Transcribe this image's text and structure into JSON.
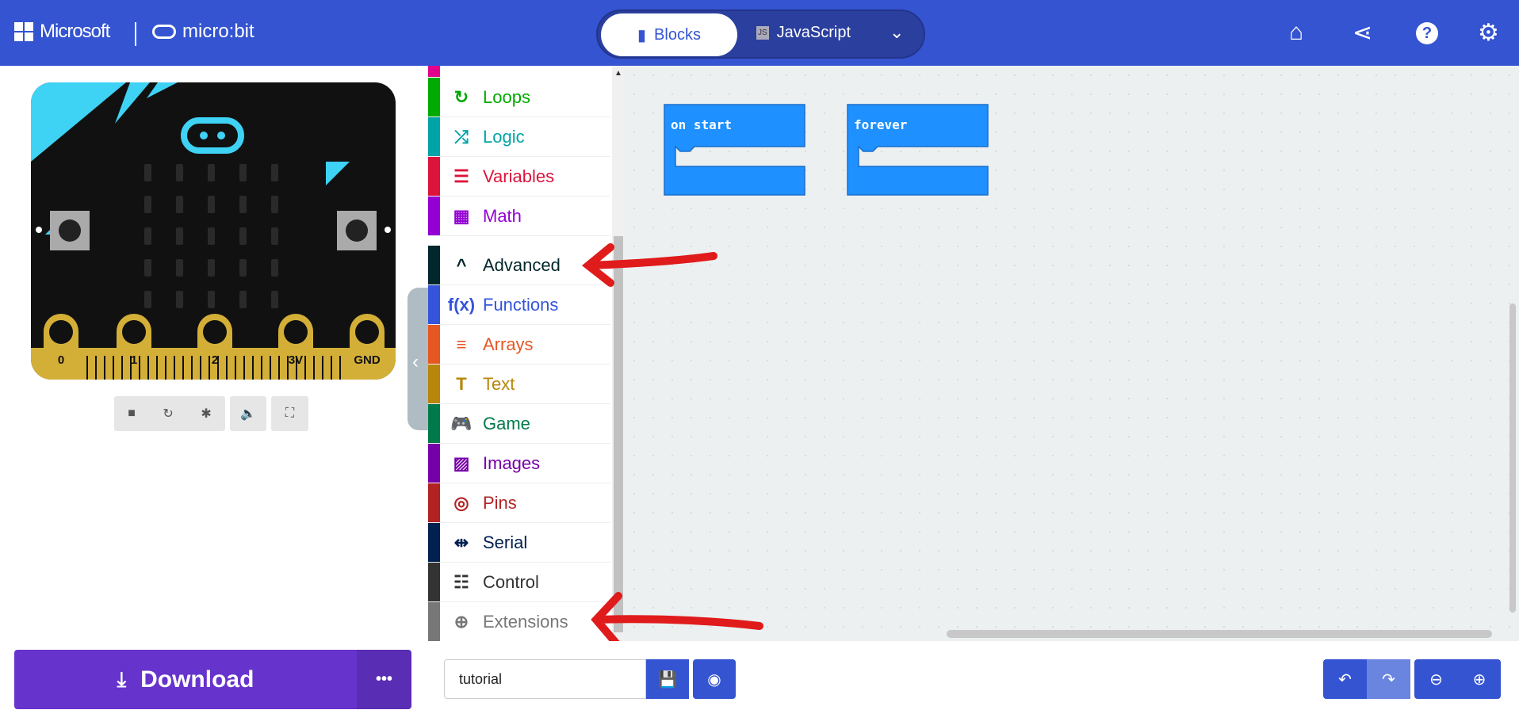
{
  "header": {
    "brand": "Microsoft",
    "product": "micro:bit",
    "tabs": [
      {
        "label": "Blocks"
      },
      {
        "label": "JavaScript"
      }
    ],
    "icons": [
      "home-icon",
      "share-icon",
      "help-icon",
      "settings-icon"
    ]
  },
  "simulator": {
    "pins": [
      "0",
      "1",
      "2",
      "3V",
      "GND"
    ],
    "buttons": [
      "A",
      "B"
    ],
    "controls": [
      "stop-icon",
      "restart-icon",
      "debug-icon",
      "mute-icon",
      "fullscreen-icon"
    ]
  },
  "toolbox": {
    "items": [
      {
        "label": "Loops",
        "icon": "↻",
        "color": "#00aa00"
      },
      {
        "label": "Logic",
        "icon": "⤮",
        "color": "#00a4a6"
      },
      {
        "label": "Variables",
        "icon": "☰",
        "color": "#dc143c"
      },
      {
        "label": "Math",
        "icon": "▦",
        "color": "#9400d3"
      },
      {
        "label": "Advanced",
        "icon": "^",
        "color": "#00272b"
      },
      {
        "label": "Functions",
        "icon": "f(x)",
        "color": "#3455db"
      },
      {
        "label": "Arrays",
        "icon": "≡",
        "color": "#e65722"
      },
      {
        "label": "Text",
        "icon": "T",
        "color": "#b8860b"
      },
      {
        "label": "Game",
        "icon": "🎮",
        "color": "#007a4b"
      },
      {
        "label": "Images",
        "icon": "▨",
        "color": "#7600a8"
      },
      {
        "label": "Pins",
        "icon": "◎",
        "color": "#b22222"
      },
      {
        "label": "Serial",
        "icon": "⇹",
        "color": "#002050"
      },
      {
        "label": "Control",
        "icon": "☷",
        "color": "#333333"
      },
      {
        "label": "Extensions",
        "icon": "⊕",
        "color": "#777777"
      }
    ]
  },
  "workspace": {
    "blocks": [
      {
        "label": "on start"
      },
      {
        "label": "forever"
      }
    ]
  },
  "bottom": {
    "download": "Download",
    "more": "•••",
    "project_name": "tutorial"
  }
}
